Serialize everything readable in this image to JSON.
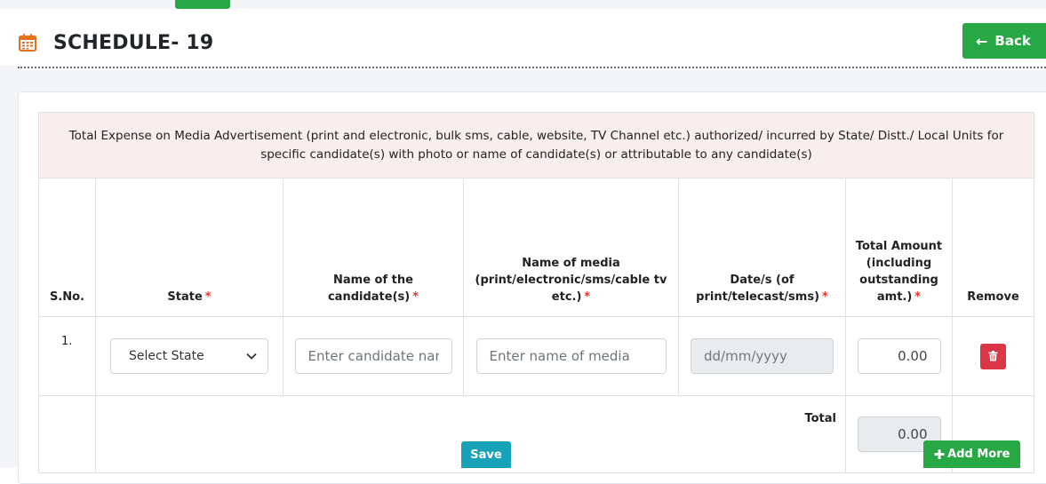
{
  "header": {
    "title": "SCHEDULE- 19",
    "back_label": "Back"
  },
  "table": {
    "caption": "Total Expense on Media Advertisement (print and electronic, bulk sms, cable, website, TV Channel etc.) authorized/ incurred by State/ Distt./ Local Units for specific candidate(s) with photo or name of candidate(s) or attributable to any candidate(s)",
    "columns": [
      {
        "label": "S.No.",
        "required": false
      },
      {
        "label": "State",
        "required": true
      },
      {
        "label": "Name of the candidate(s)",
        "required": true
      },
      {
        "label": "Name of media (print/electronic/sms/cable tv etc.)",
        "required": true
      },
      {
        "label": "Date/s (of print/telecast/sms)",
        "required": true
      },
      {
        "label": "Total Amount (including outstanding amt.)",
        "required": true
      },
      {
        "label": "Remove",
        "required": false
      }
    ],
    "required_mark": "*",
    "rows": [
      {
        "sno": "1.",
        "state_selected": "Select State",
        "candidate_placeholder": "Enter candidate name",
        "media_placeholder": "Enter name of media",
        "date_placeholder": "dd/mm/yyyy",
        "amount": "0.00"
      }
    ],
    "total_label": "Total",
    "total_value": "0.00"
  },
  "actions": {
    "save_label": "Save",
    "add_more_label": "Add More"
  },
  "icons": {
    "title_icon": "calendar-icon",
    "back_icon": "arrow-left-icon",
    "remove_icon": "trash-icon",
    "add_icon": "plus-icon"
  },
  "colors": {
    "success": "#28a745",
    "info": "#17a2b8",
    "danger": "#dc3545",
    "title_icon": "#e8711c",
    "caption_bg": "#f8eeee"
  }
}
